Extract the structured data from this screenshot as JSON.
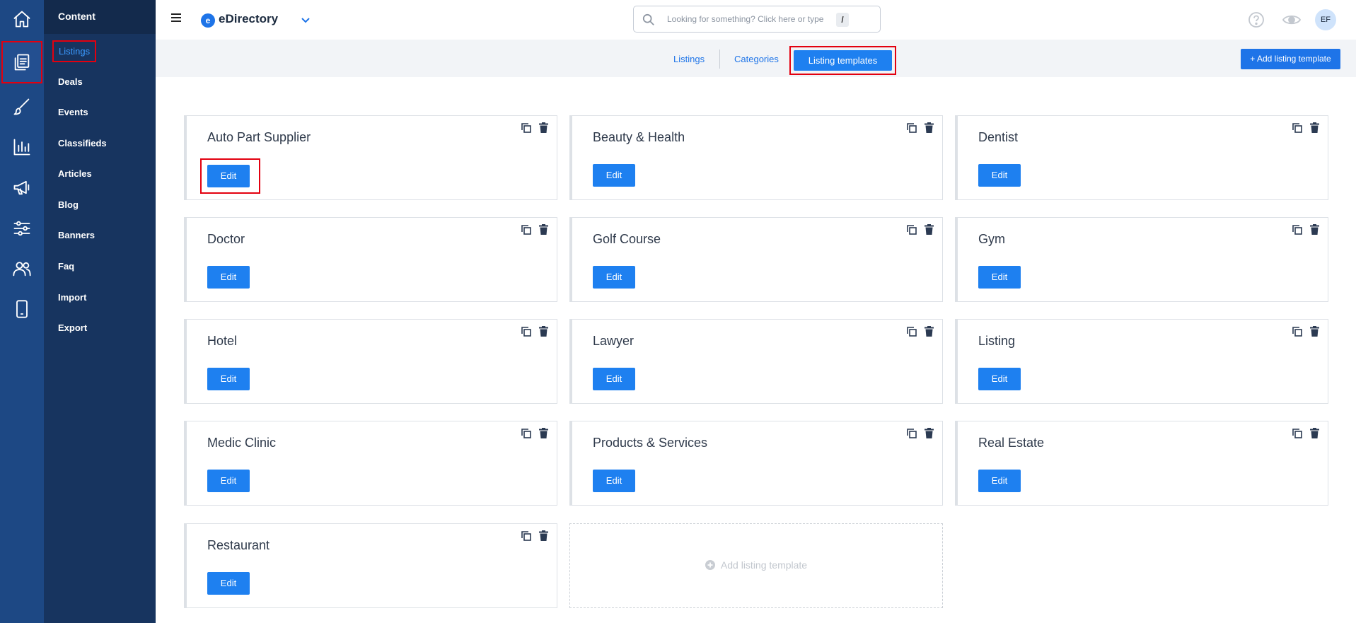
{
  "rail": {
    "icons": [
      "home-icon",
      "content-icon",
      "brush-icon",
      "chart-icon",
      "megaphone-icon",
      "sliders-icon",
      "users-icon",
      "mobile-icon"
    ]
  },
  "submenu": {
    "title": "Content",
    "items": [
      {
        "label": "Listings"
      },
      {
        "label": "Deals"
      },
      {
        "label": "Events"
      },
      {
        "label": "Classifieds"
      },
      {
        "label": "Articles"
      },
      {
        "label": "Blog"
      },
      {
        "label": "Banners"
      },
      {
        "label": "Faq"
      },
      {
        "label": "Import"
      },
      {
        "label": "Export"
      }
    ]
  },
  "header": {
    "logo_mark": "e",
    "logo_text": "eDirectory",
    "search_placeholder": "Looking for something? Click here or type",
    "search_shortcut": "/",
    "avatar_initials": "EF"
  },
  "tabs": {
    "items": [
      {
        "label": "Listings"
      },
      {
        "label": "Categories"
      },
      {
        "label": "Listing templates"
      }
    ],
    "active": "Listing templates",
    "add_button_label": "Add listing template"
  },
  "templates": [
    {
      "title": "Auto Part Supplier",
      "edit_label": "Edit"
    },
    {
      "title": "Beauty & Health",
      "edit_label": "Edit"
    },
    {
      "title": "Dentist",
      "edit_label": "Edit"
    },
    {
      "title": "Doctor",
      "edit_label": "Edit"
    },
    {
      "title": "Golf Course",
      "edit_label": "Edit"
    },
    {
      "title": "Gym",
      "edit_label": "Edit"
    },
    {
      "title": "Hotel",
      "edit_label": "Edit"
    },
    {
      "title": "Lawyer",
      "edit_label": "Edit"
    },
    {
      "title": "Listing",
      "edit_label": "Edit"
    },
    {
      "title": "Medic Clinic",
      "edit_label": "Edit"
    },
    {
      "title": "Products & Services",
      "edit_label": "Edit"
    },
    {
      "title": "Real Estate",
      "edit_label": "Edit"
    },
    {
      "title": "Restaurant",
      "edit_label": "Edit"
    }
  ],
  "add_card_label": "Add listing template",
  "colors": {
    "rail": "#1d4884",
    "submenu": "#17345f",
    "accent": "#1e74e8",
    "highlight": "#e3000f"
  }
}
